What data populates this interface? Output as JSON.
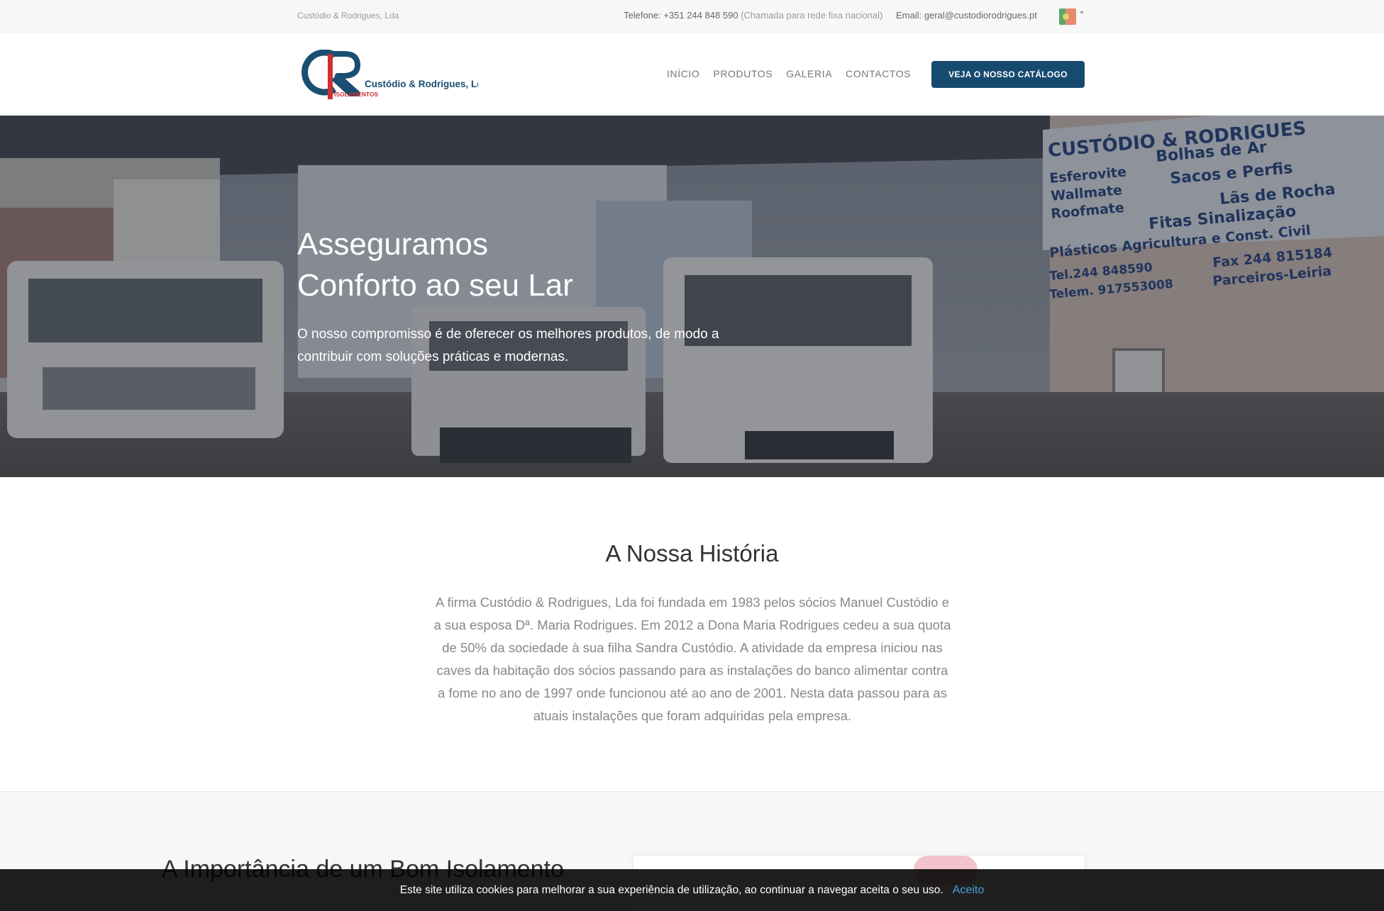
{
  "topbar": {
    "company": "Custódio & Rodrigues, Lda",
    "phone_label": "Telefone: +351 244 848 590",
    "phone_note": "(Chamada para rede fixa nacional)",
    "email_label": "Email: geral@custodiorodrigues.pt",
    "language_icon": "portugal-flag-icon"
  },
  "logo": {
    "letters": "CR",
    "name": "Custódio & Rodrigues, Lda",
    "tagline": "ISOLAMENTOS"
  },
  "nav": {
    "items": [
      "INÍCIO",
      "PRODUTOS",
      "GALERIA",
      "CONTACTOS"
    ],
    "cta": "VEJA O NOSSO CATÁLOGO"
  },
  "hero": {
    "title_line1": "Asseguramos",
    "title_line2": "Conforto ao seu Lar",
    "text": "O nosso compromisso é de oferecer os melhores produtos, de modo a contribuir com soluções práticas e modernas.",
    "sign_lines": [
      "CUSTÓDIO & RODRIGUES",
      "Esferovite",
      "Bolhas de Ar",
      "Wallmate",
      "Sacos e Perfis",
      "Roofmate",
      "Lãs de Rocha",
      "Fitas Sinalização",
      "Plásticos Agricultura e Const. Civil",
      "Tel.244 848590",
      "Fax 244 815184",
      "Telem. 917553008",
      "Parceiros-Leiria"
    ]
  },
  "history": {
    "title": "A Nossa História",
    "text": "A firma Custódio & Rodrigues, Lda foi fundada em 1983 pelos sócios Manuel Custódio e a sua esposa Dª. Maria Rodrigues. Em 2012 a Dona Maria Rodrigues cedeu a sua quota de 50% da sociedade à sua filha Sandra Custódio. A atividade da empresa iniciou nas caves da habitação dos sócios passando para as instalações do banco alimentar contra a fome no ano de 1997 onde funcionou até ao ano de 2001. Nesta data passou para as atuais instalações que foram adquiridas pela empresa."
  },
  "next": {
    "title": "A Importância de um Bom Isolamento"
  },
  "cookie": {
    "message": "Este site utiliza cookies para melhorar a sua experiência de utilização, ao continuar a navegar aceita o seu uso.",
    "accept": "Aceito"
  }
}
